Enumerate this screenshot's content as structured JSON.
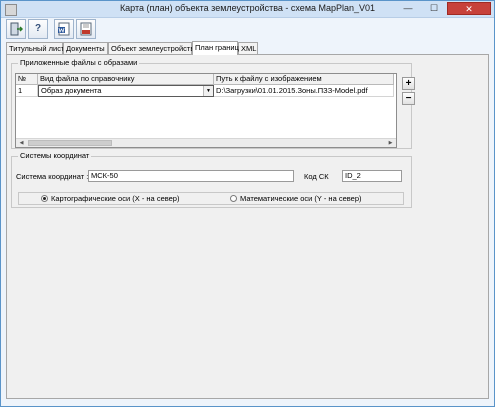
{
  "window": {
    "title": "Карта (план) объекта землеустройства - схема MapPlan_V01",
    "minimize": "—",
    "maximize": "☐",
    "close": "✕"
  },
  "toolbar": {
    "help_label": "?"
  },
  "tabs": [
    "Титульный лист",
    "Документы",
    "Объект землеустройства",
    "План границ",
    "XML"
  ],
  "attached_files": {
    "title": "Приложенные файлы с образами",
    "columns": [
      "№",
      "Вид файла по справочнику",
      "Путь к файлу с изображением"
    ],
    "rows": [
      {
        "num": "1",
        "type": "Образ документа",
        "path": "D:\\Загрузки\\01.01.2015.Зоны.ПЗЗ-Model.pdf"
      }
    ],
    "add_label": "+",
    "remove_label": "−"
  },
  "coordinate_systems": {
    "title": "Системы координат",
    "system_label": "Система координат :",
    "system_value": "МСК-50",
    "code_label": "Код СК",
    "code_value": "ID_2",
    "radio_options": [
      {
        "label": "Картографические оси (X - на север)",
        "checked": true
      },
      {
        "label": "Математические оси (Y - на север)",
        "checked": false
      }
    ]
  }
}
